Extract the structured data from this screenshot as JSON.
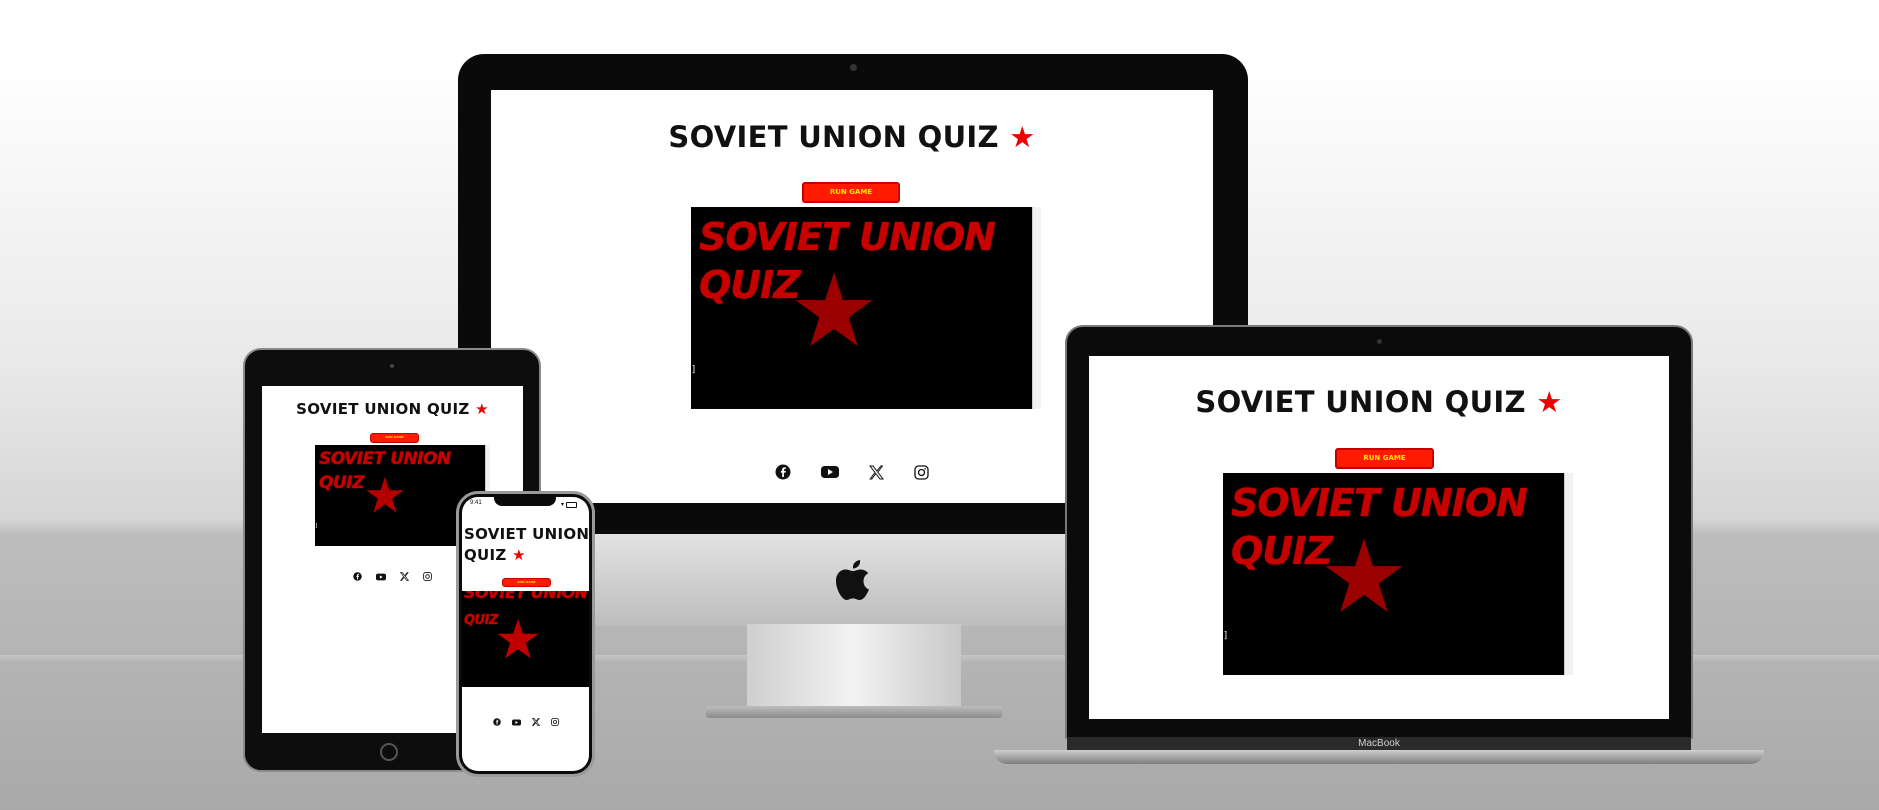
{
  "app": {
    "title": "SOVIET UNION QUIZ",
    "star": "★",
    "run_button": "RUN GAME",
    "terminal_line1": "SOVIET UNION",
    "terminal_line2": "QUIZ",
    "cursor": "]"
  },
  "phone_app": {
    "title_line1": "SOVIET UNION",
    "title_line2": "QUIZ"
  },
  "phone_status": {
    "time": "9:41"
  },
  "socials": [
    {
      "name": "facebook",
      "icon": "facebook-icon"
    },
    {
      "name": "youtube",
      "icon": "youtube-icon"
    },
    {
      "name": "x",
      "icon": "x-icon"
    },
    {
      "name": "instagram",
      "icon": "instagram-icon"
    }
  ],
  "devices": {
    "laptop_brand": "MacBook"
  },
  "colors": {
    "accent_red": "#ff1a00",
    "button_text": "#ffe600",
    "terminal_bg": "#000000",
    "terminal_text": "#c70000"
  }
}
